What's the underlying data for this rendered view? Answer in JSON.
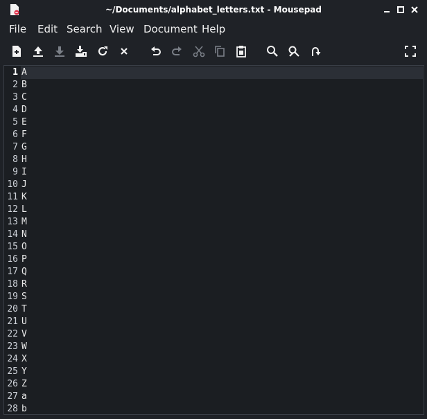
{
  "window": {
    "title": "~/Documents/alphabet_letters.txt - Mousepad",
    "controls": [
      "minimize-icon",
      "maximize-icon",
      "close-icon"
    ]
  },
  "menubar": {
    "items": [
      "File",
      "Edit",
      "Search",
      "View",
      "Document",
      "Help"
    ]
  },
  "toolbar": {
    "icons": [
      "new-document-icon",
      "open-icon",
      "save-icon",
      "save-as-icon",
      "reload-icon",
      "close-tab-icon",
      "undo-icon",
      "redo-icon",
      "cut-icon",
      "copy-icon",
      "paste-icon",
      "find-icon",
      "find-replace-icon",
      "goto-line-icon",
      "fullscreen-icon"
    ]
  },
  "editor": {
    "current_line": 1,
    "lines": [
      {
        "n": "1",
        "t": "A"
      },
      {
        "n": "2",
        "t": "B"
      },
      {
        "n": "3",
        "t": "C"
      },
      {
        "n": "4",
        "t": "D"
      },
      {
        "n": "5",
        "t": "E"
      },
      {
        "n": "6",
        "t": "F"
      },
      {
        "n": "7",
        "t": "G"
      },
      {
        "n": "8",
        "t": "H"
      },
      {
        "n": "9",
        "t": "I"
      },
      {
        "n": "10",
        "t": "J"
      },
      {
        "n": "11",
        "t": "K"
      },
      {
        "n": "12",
        "t": "L"
      },
      {
        "n": "13",
        "t": "M"
      },
      {
        "n": "14",
        "t": "N"
      },
      {
        "n": "15",
        "t": "O"
      },
      {
        "n": "16",
        "t": "P"
      },
      {
        "n": "17",
        "t": "Q"
      },
      {
        "n": "18",
        "t": "R"
      },
      {
        "n": "19",
        "t": "S"
      },
      {
        "n": "20",
        "t": "T"
      },
      {
        "n": "21",
        "t": "U"
      },
      {
        "n": "22",
        "t": "V"
      },
      {
        "n": "23",
        "t": "W"
      },
      {
        "n": "24",
        "t": "X"
      },
      {
        "n": "25",
        "t": "Y"
      },
      {
        "n": "26",
        "t": "Z"
      },
      {
        "n": "27",
        "t": "a"
      },
      {
        "n": "28",
        "t": "b"
      }
    ]
  },
  "colors": {
    "background": "#1e2126",
    "editor_bg": "#1b1e22",
    "current_line_bg": "#2b2f36",
    "accent_red": "#e0304a"
  }
}
